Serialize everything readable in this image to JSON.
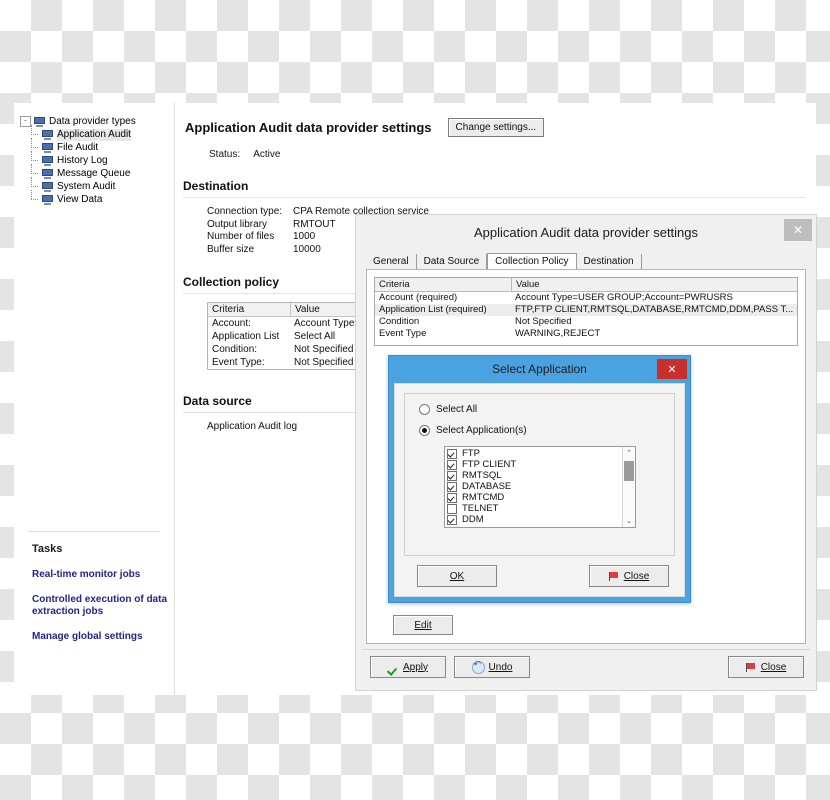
{
  "tree": {
    "root": {
      "label": "Data provider types",
      "icon": "computer-icon",
      "expander": "-"
    },
    "items": [
      {
        "label": "Application Audit",
        "icon": "computer-icon"
      },
      {
        "label": "File Audit",
        "icon": "computer-icon"
      },
      {
        "label": "History Log",
        "icon": "computer-icon"
      },
      {
        "label": "Message Queue",
        "icon": "computer-icon"
      },
      {
        "label": "System Audit",
        "icon": "computer-icon"
      },
      {
        "label": "View Data",
        "icon": "computer-icon"
      }
    ]
  },
  "tasks": {
    "title": "Tasks",
    "links": [
      "Real-time monitor jobs",
      "Controlled execution of data extraction jobs",
      "Manage global settings"
    ]
  },
  "page": {
    "title": "Application Audit data provider settings",
    "change_settings_label": "Change settings...",
    "status_label": "Status:",
    "status_value": "Active",
    "destination": {
      "heading": "Destination",
      "rows": [
        {
          "k": "Connection type:",
          "v": "CPA Remote collection service"
        },
        {
          "k": "Output library",
          "v": "RMTOUT"
        },
        {
          "k": "Number of files",
          "v": "1000"
        },
        {
          "k": "Buffer size",
          "v": "10000"
        }
      ]
    },
    "collection_policy": {
      "heading": "Collection policy",
      "headers": [
        "Criteria",
        "Value"
      ],
      "rows": [
        {
          "criteria": "Account:",
          "value": "Account Type="
        },
        {
          "criteria": "Application List",
          "value": "Select All"
        },
        {
          "criteria": "Condition:",
          "value": "Not Specified"
        },
        {
          "criteria": "Event Type:",
          "value": "Not Specified"
        }
      ]
    },
    "data_source": {
      "heading": "Data source",
      "value": "Application Audit log"
    }
  },
  "settings_dialog": {
    "title": "Application Audit data provider settings",
    "close_glyph": "✕",
    "tabs": [
      {
        "label": "General",
        "active": false
      },
      {
        "label": "Data Source",
        "active": false
      },
      {
        "label": "Collection Policy",
        "active": true
      },
      {
        "label": "Destination",
        "active": false
      }
    ],
    "grid": {
      "headers": [
        "Criteria",
        "Value"
      ],
      "rows": [
        {
          "criteria": "Account  (required)",
          "value": "Account Type=USER GROUP;Account=PWRUSRS"
        },
        {
          "criteria": "Application List  (required)",
          "value": "FTP,FTP CLIENT,RMTSQL,DATABASE,RMTCMD,DDM,PASS T..."
        },
        {
          "criteria": "Condition",
          "value": "Not Specified"
        },
        {
          "criteria": "Event Type",
          "value": "WARNING,REJECT"
        }
      ]
    },
    "edit_label": "Edit",
    "footer": {
      "apply": "Apply",
      "undo": "Undo",
      "close": "Close"
    }
  },
  "select_application_dialog": {
    "title": "Select Application",
    "close_glyph": "✕",
    "radio_select_all": "Select All",
    "radio_select_apps": "Select Application(s)",
    "selected_radio": "select_apps",
    "applications": [
      {
        "name": "FTP",
        "checked": true
      },
      {
        "name": "FTP CLIENT",
        "checked": true
      },
      {
        "name": "RMTSQL",
        "checked": true
      },
      {
        "name": "DATABASE",
        "checked": true
      },
      {
        "name": "RMTCMD",
        "checked": true
      },
      {
        "name": "TELNET",
        "checked": false
      },
      {
        "name": "DDM",
        "checked": true
      }
    ],
    "scroll_up_glyph": "⌃",
    "scroll_down_glyph": "⌄",
    "ok_label": "OK",
    "close_label": "Close"
  },
  "colors": {
    "dialog_accent": "#4aa3e0",
    "close_red": "#c9302c",
    "task_link": "#23238c"
  }
}
